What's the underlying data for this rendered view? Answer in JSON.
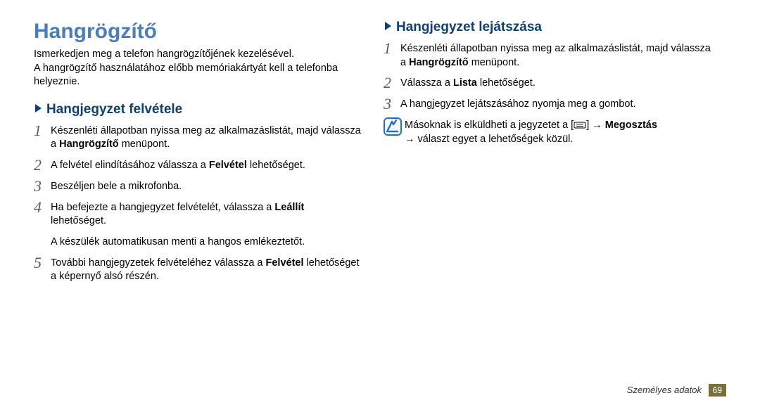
{
  "left": {
    "title": "Hangrögzítő",
    "intro_line1": "Ismerkedjen meg a telefon hangrögzítőjének kezelésével.",
    "intro_line2": "A hangrögzítő használatához előbb memóriakártyát kell a telefonba helyeznie.",
    "sub1": "Hangjegyzet felvétele",
    "steps": {
      "s1_a": "Készenléti állapotban nyissa meg az alkalmazáslistát, majd válassza a ",
      "s1_bold": "Hangrögzítő",
      "s1_b": " menüpont.",
      "s2_a": "A felvétel elindításához válassza a ",
      "s2_bold": "Felvétel",
      "s2_b": " lehetőséget.",
      "s3": "Beszéljen bele a mikrofonba.",
      "s4_a": "Ha befejezte a hangjegyzet felvételét, válassza a ",
      "s4_bold": "Leállít",
      "s4_b": " lehetőséget.",
      "s4_note": "A készülék automatikusan menti a hangos emlékeztetőt.",
      "s5_a": "További hangjegyzetek felvételéhez válassza a ",
      "s5_bold": "Felvétel",
      "s5_b": " lehetőséget a képernyő alsó részén."
    }
  },
  "right": {
    "sub1": "Hangjegyzet lejátszása",
    "steps": {
      "s1_a": "Készenléti állapotban nyissa meg az alkalmazáslistát, majd válassza a ",
      "s1_bold": "Hangrögzítő",
      "s1_b": " menüpont.",
      "s2_a": "Válassza a ",
      "s2_bold": "Lista",
      "s2_b": " lehetőséget.",
      "s3": "A hangjegyzet lejátszásához nyomja meg a gombot."
    },
    "note_a": "Másoknak is elküldheti a jegyzetet a [",
    "note_b": "] → ",
    "note_bold": "Megosztás",
    "note_c": " → választ egyet a lehetőségek közül."
  },
  "footer": {
    "label": "Személyes adatok",
    "page": "69"
  }
}
